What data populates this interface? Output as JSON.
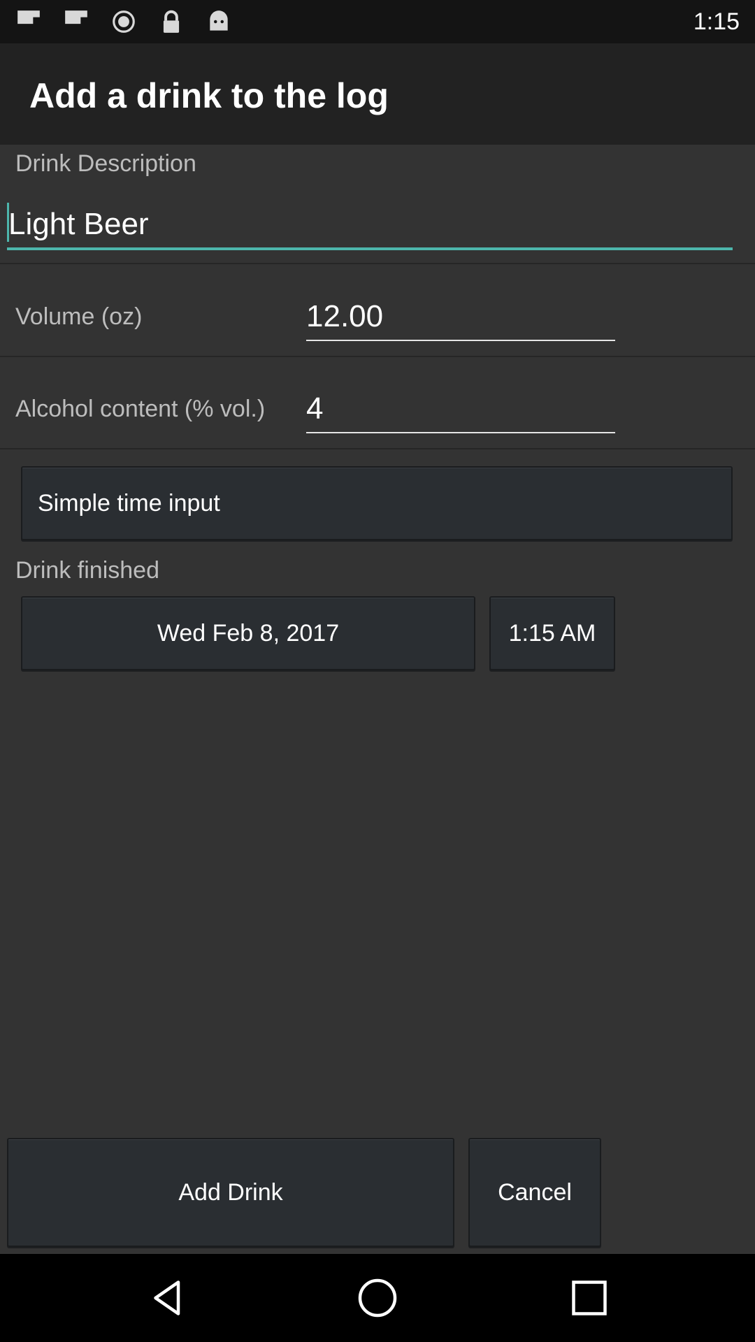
{
  "status_bar": {
    "time": "1:15",
    "icons": [
      "flipboard-icon",
      "flipboard-icon",
      "alarm-icon",
      "lock-icon",
      "android-icon"
    ]
  },
  "app_bar": {
    "title": "Add a drink to the log"
  },
  "form": {
    "description_label": "Drink Description",
    "description_value": "Light Beer",
    "volume_label": "Volume (oz)",
    "volume_value": "12.00",
    "alcohol_label": "Alcohol content (% vol.)",
    "alcohol_value": "4",
    "simple_time_button": "Simple time input",
    "finished_label": "Drink finished",
    "date_value": "Wed Feb 8, 2017",
    "time_value": "1:15 AM"
  },
  "actions": {
    "add_label": "Add Drink",
    "cancel_label": "Cancel"
  },
  "nav": [
    "back-icon",
    "home-icon",
    "recents-icon"
  ],
  "colors": {
    "accent": "#4db6ac",
    "background": "#333333",
    "app_bar": "#222222",
    "button": "#2a2e32"
  }
}
